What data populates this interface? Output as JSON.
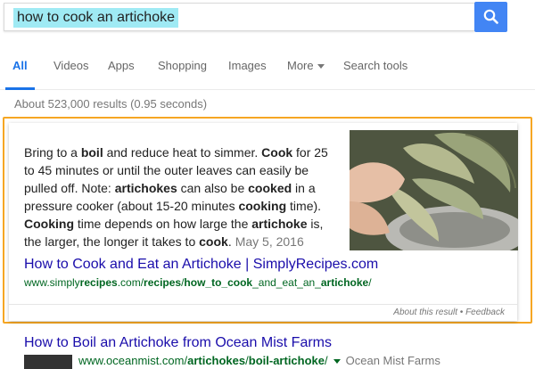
{
  "search": {
    "query": "how to cook an artichoke",
    "button_icon": "search-icon"
  },
  "tabs": [
    {
      "label": "All",
      "active": true
    },
    {
      "label": "Videos"
    },
    {
      "label": "Apps"
    },
    {
      "label": "Shopping"
    },
    {
      "label": "Images"
    },
    {
      "label": "More"
    },
    {
      "label": "Search tools"
    }
  ],
  "stats": "About 523,000 results (0.95 seconds)",
  "featured_snippet": {
    "text_segments": [
      {
        "t": "Bring to a ",
        "b": false
      },
      {
        "t": "boil",
        "b": true
      },
      {
        "t": " and reduce heat to simmer. ",
        "b": false
      },
      {
        "t": "Cook",
        "b": true
      },
      {
        "t": " for 25 to 45 minutes or until the outer leaves can easily be pulled off. Note: ",
        "b": false
      },
      {
        "t": "artichokes",
        "b": true
      },
      {
        "t": " can also be ",
        "b": false
      },
      {
        "t": "cooked",
        "b": true
      },
      {
        "t": " in a pressure cooker (about 15-20 minutes ",
        "b": false
      },
      {
        "t": "cooking",
        "b": true
      },
      {
        "t": " time). ",
        "b": false
      },
      {
        "t": "Cooking",
        "b": true
      },
      {
        "t": " time depends on how large the ",
        "b": false
      },
      {
        "t": "artichoke",
        "b": true
      },
      {
        "t": " is, the larger, the longer it takes to ",
        "b": false
      },
      {
        "t": "cook",
        "b": true
      },
      {
        "t": ".",
        "b": false
      }
    ],
    "date": "May 5, 2016",
    "title": "How to Cook and Eat an Artichoke | SimplyRecipes.com",
    "url_segments": [
      {
        "t": "www.simply",
        "b": false
      },
      {
        "t": "recipes",
        "b": true
      },
      {
        "t": ".com/",
        "b": false
      },
      {
        "t": "recipes",
        "b": true
      },
      {
        "t": "/",
        "b": false
      },
      {
        "t": "how_to_cook",
        "b": true
      },
      {
        "t": "_and_eat_an_",
        "b": false
      },
      {
        "t": "artichoke",
        "b": true
      },
      {
        "t": "/",
        "b": false
      }
    ],
    "footer": {
      "about": "About this result",
      "separator": " • ",
      "feedback": "Feedback"
    },
    "highlight_color": "#f6a623"
  },
  "result2": {
    "title": "How to Boil an Artichoke from Ocean Mist Farms",
    "url_segments": [
      {
        "t": "www.oceanmist.com/",
        "b": false
      },
      {
        "t": "artichokes",
        "b": true
      },
      {
        "t": "/",
        "b": false
      },
      {
        "t": "boil-artichoke",
        "b": true
      },
      {
        "t": "/",
        "b": false
      }
    ],
    "source": "Ocean Mist Farms"
  },
  "colors": {
    "accent": "#4285f4",
    "link": "#1a0dab",
    "url": "#006621",
    "query_highlight": "#9feaf4"
  }
}
